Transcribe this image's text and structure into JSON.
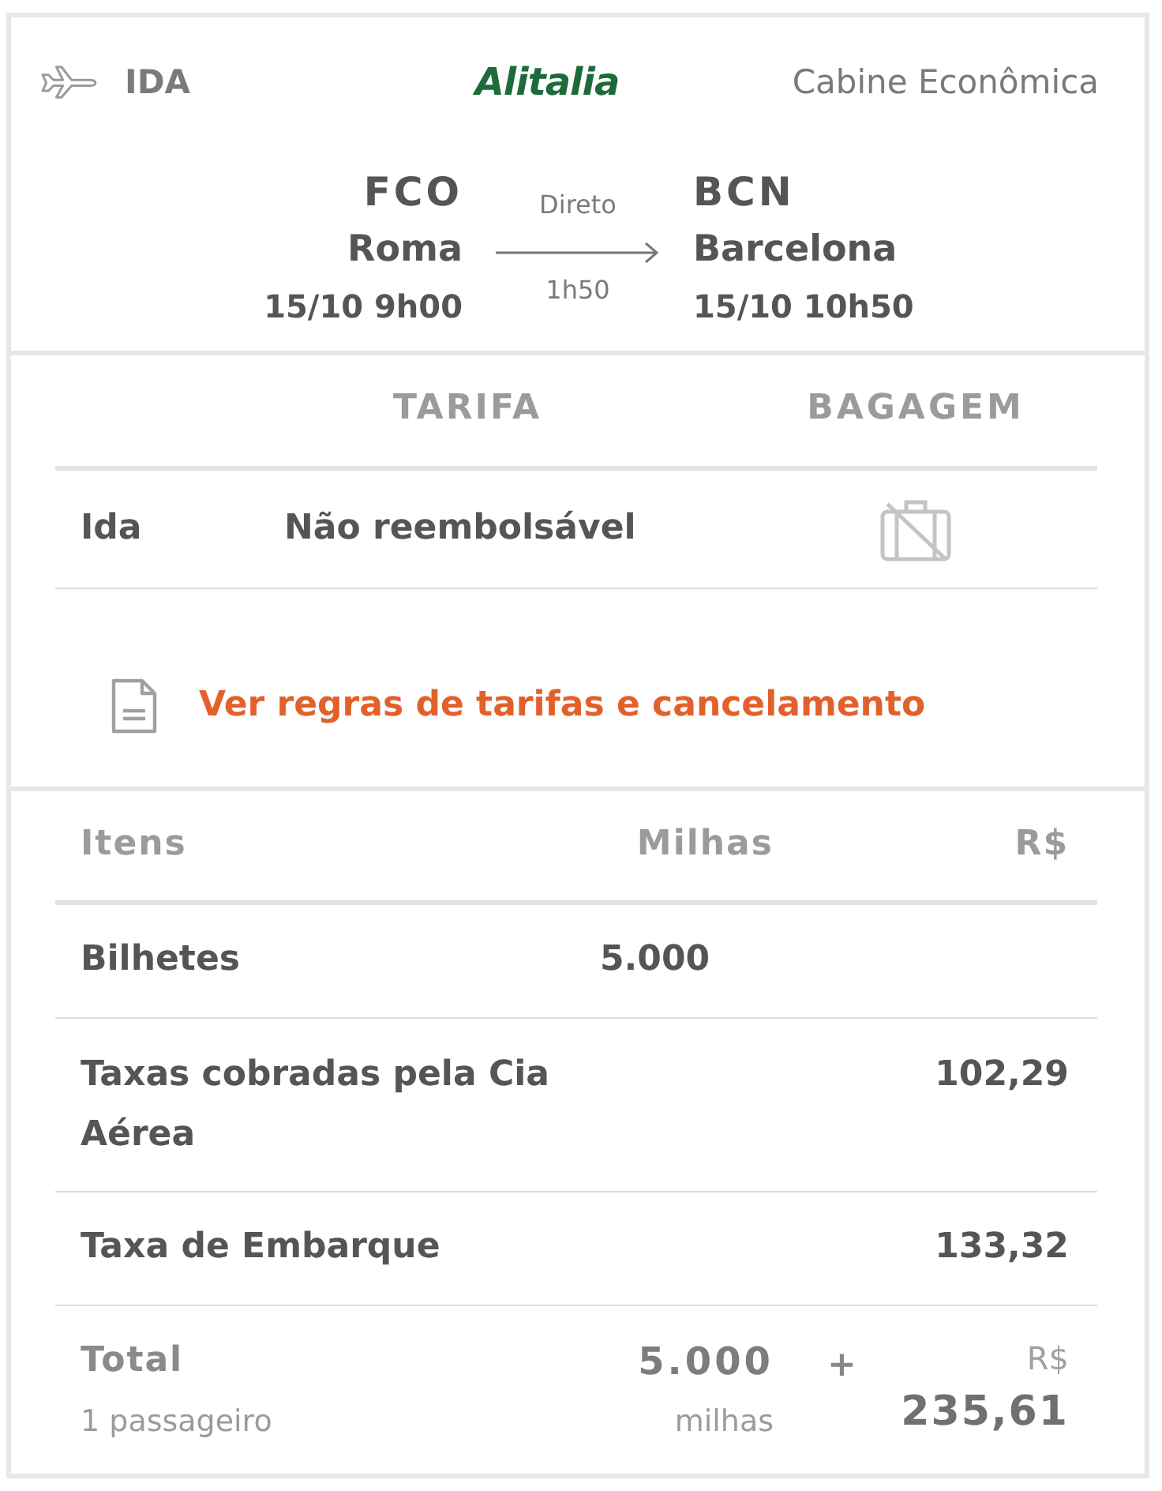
{
  "header": {
    "direction": "IDA",
    "airline_logo": "Alitalia",
    "cabin": "Cabine Econômica"
  },
  "route": {
    "origin": {
      "code": "FCO",
      "city": "Roma",
      "datetime": "15/10 9h00"
    },
    "stops": "Direto",
    "duration": "1h50",
    "destination": {
      "code": "BCN",
      "city": "Barcelona",
      "datetime": "15/10 10h50"
    }
  },
  "fare_table": {
    "columns": [
      "TARIFA",
      "BAGAGEM"
    ],
    "rows": [
      {
        "leg": "Ida",
        "fare": "Não reembolsável",
        "baggage_included": false
      }
    ]
  },
  "rules_link": "Ver regras de tarifas e cancelamento",
  "price_table": {
    "columns": [
      "Itens",
      "Milhas",
      "R$"
    ],
    "rows": [
      {
        "item": "Bilhetes",
        "miles": "5.000"
      },
      {
        "item": "Taxas cobradas pela Cia Aérea",
        "amount": "102,29"
      },
      {
        "item": "Taxa de Embarque",
        "amount": "133,32"
      }
    ],
    "total": {
      "label": "Total",
      "passengers": "1 passageiro",
      "miles": "5.000",
      "miles_unit": "milhas",
      "plus": "+",
      "currency": "R$",
      "amount": "235,61"
    }
  }
}
